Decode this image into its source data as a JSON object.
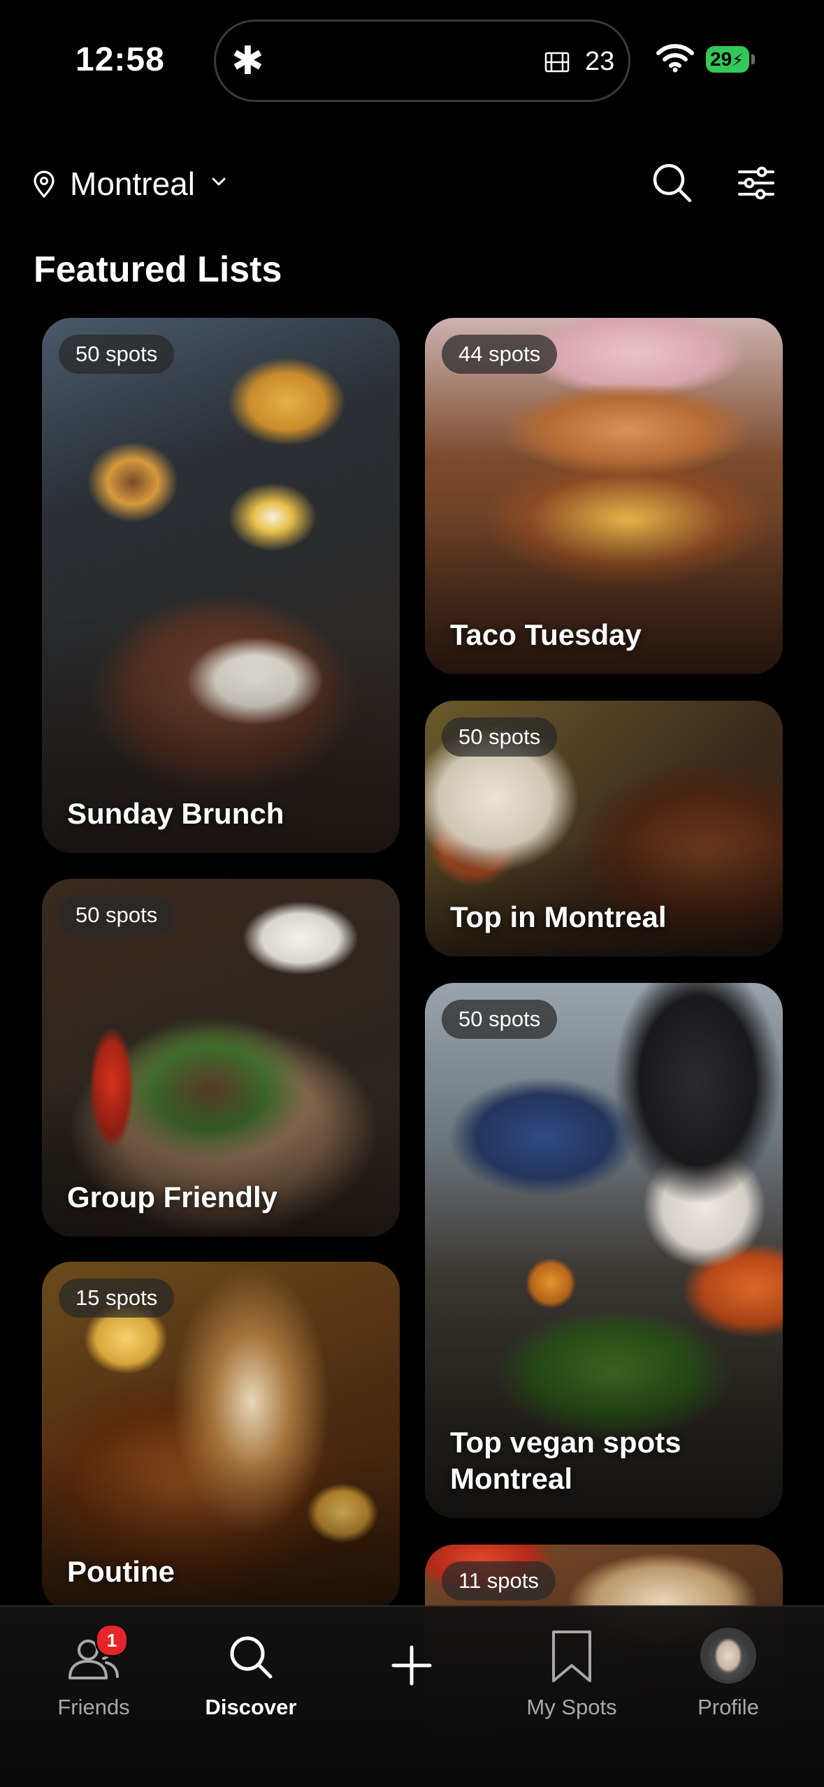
{
  "status_bar": {
    "time": "12:58",
    "island_icon": "asterisk-icon",
    "island_count": "23",
    "battery": "29"
  },
  "header": {
    "location": "Montreal",
    "icons": [
      "location-pin-icon",
      "chevron-down-icon",
      "search-icon",
      "filter-sliders-icon"
    ]
  },
  "section": {
    "title": "Featured Lists"
  },
  "lists": [
    {
      "spots": "50 spots",
      "title": "Sunday Brunch"
    },
    {
      "spots": "44 spots",
      "title": "Taco Tuesday"
    },
    {
      "spots": "50 spots",
      "title": "Top in Montreal"
    },
    {
      "spots": "50 spots",
      "title": "Group Friendly"
    },
    {
      "spots": "50 spots",
      "title": "Top vegan spots Montreal"
    },
    {
      "spots": "15 spots",
      "title": "Poutine"
    },
    {
      "spots": "11 spots",
      "title": ""
    }
  ],
  "nav": {
    "items": [
      {
        "label": "Friends",
        "badge": "1",
        "icon": "friends-icon"
      },
      {
        "label": "Discover",
        "icon": "search-icon",
        "active": true
      },
      {
        "label": "",
        "icon": "plus-icon"
      },
      {
        "label": "My Spots",
        "icon": "bookmark-icon"
      },
      {
        "label": "Profile",
        "icon": "avatar"
      }
    ]
  },
  "colors": {
    "background": "#000000",
    "battery": "#34c759",
    "badge": "#e5252a"
  }
}
